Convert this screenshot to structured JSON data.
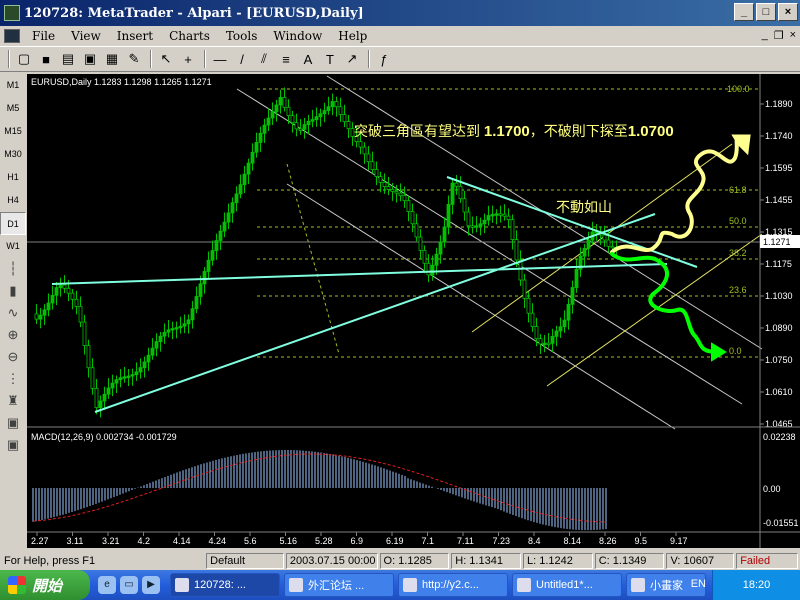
{
  "window": {
    "title": "120728: MetaTrader - Alpari - [EURUSD,Daily]",
    "min": "_",
    "max": "□",
    "close": "×"
  },
  "menu": {
    "items": [
      "File",
      "View",
      "Insert",
      "Charts",
      "Tools",
      "Window",
      "Help"
    ],
    "mdi_min": "_",
    "mdi_restore": "❐",
    "mdi_close": "×"
  },
  "toolbar": {
    "icons": [
      "new-chart-icon",
      "save-icon",
      "print-icon",
      "print-preview-icon",
      "properties-icon",
      "expert-icon",
      "cursor-icon",
      "crosshair-icon",
      "hline-icon",
      "trendline-icon",
      "equidistant-channel-icon",
      "fibonacci-icon",
      "text-icon",
      "label-icon",
      "arrow-icon",
      "script-icon"
    ],
    "glyphs": [
      "▢",
      "■",
      "▤",
      "▣",
      "▦",
      "✎",
      "↖",
      "+",
      "—",
      "/",
      "⫽",
      "≡",
      "A",
      "T",
      "↗",
      "ƒ"
    ]
  },
  "periods": [
    "M1",
    "M5",
    "M15",
    "M30",
    "H1",
    "H4",
    "D1",
    "W1"
  ],
  "active_period": "D1",
  "chart": {
    "header": "EURUSD,Daily  1.1283 1.1298 1.1265 1.1271",
    "annotation_main": "突破三角區有望达到 ",
    "annotation_v1": "1.1700",
    "annotation_mid": "，不破則下探至",
    "annotation_v2": "1.0700",
    "annotation_small": "不動如山",
    "price_labels": [
      "1.1890",
      "1.1740",
      "1.1595",
      "1.1455",
      "1.1315",
      "1.1175",
      "1.1030",
      "1.0890",
      "1.0750",
      "1.0610",
      "1.0465"
    ],
    "current_price": "1.1271",
    "fib_labels": [
      "100.0",
      "61.8",
      "50.0",
      "38.2",
      "23.6",
      "0.0"
    ],
    "date_labels": [
      "2.27",
      "3.11",
      "3.21",
      "4.2",
      "4.14",
      "4.24",
      "5.6",
      "5.16",
      "5.28",
      "6.9",
      "6.19",
      "7.1",
      "7.11",
      "7.23",
      "8.4",
      "8.14",
      "8.26",
      "9.5",
      "9.17"
    ],
    "macd_header": "MACD(12,26,9)  0.002734  -0.001729",
    "macd_labels": [
      "0.02238",
      "0.00",
      "-0.01551"
    ],
    "colors": {
      "candle": "#00c000",
      "fib": "#a0c020",
      "channel": "#c8c8c8",
      "triangle": "#80ffe0",
      "yellow_channel": "#e0e060",
      "annotation": "#ffff80",
      "arrow_up": "#ffff90",
      "arrow_down": "#00ff00"
    }
  },
  "status": {
    "help": "For Help, press F1",
    "profile": "Default",
    "time": "2003.07.15 00:00",
    "open": "O: 1.1285",
    "high": "H: 1.1341",
    "low": "L: 1.1242",
    "close": "C: 1.1349",
    "volume": "V: 10607",
    "conn": "Failed"
  },
  "taskbar": {
    "start": "開始",
    "tasks": [
      "120728: ...",
      "外汇论坛 ...",
      "http://y2.c...",
      "Untitled1*...",
      "小畫家"
    ],
    "lang": "EN",
    "clock": "18:20"
  }
}
